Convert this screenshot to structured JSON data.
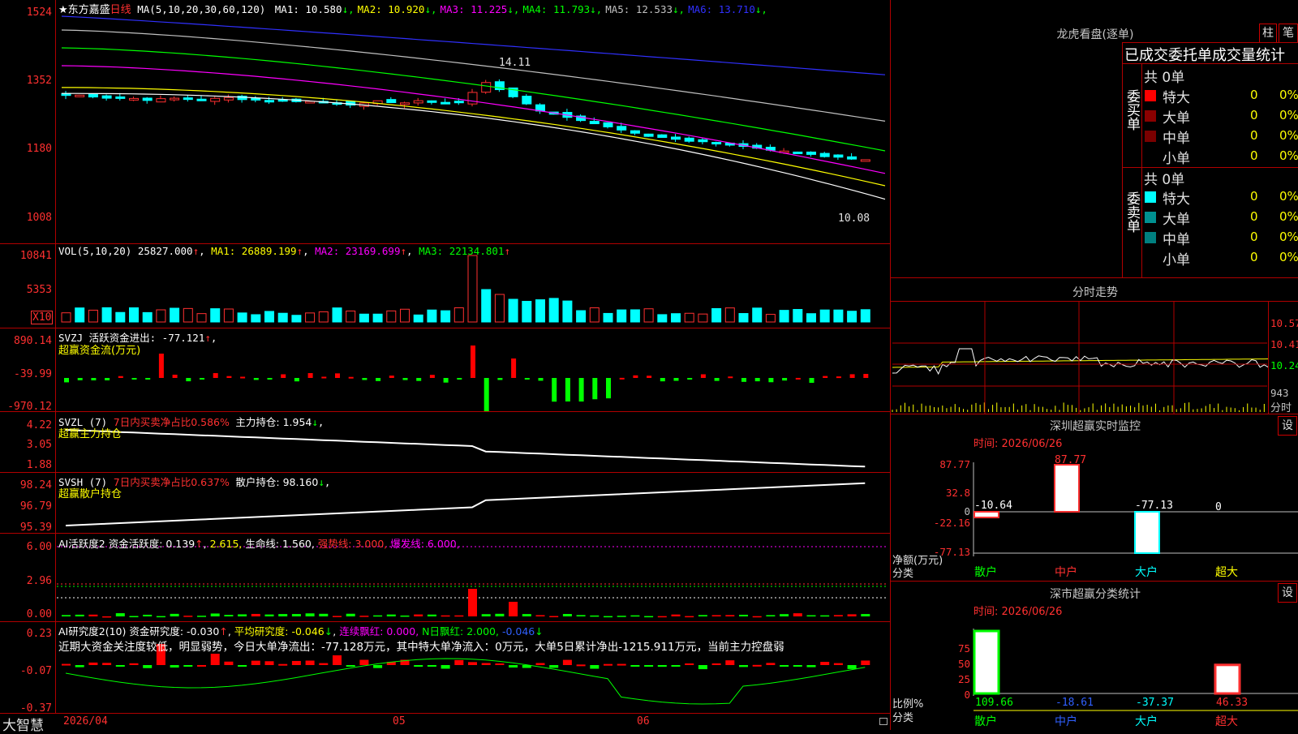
{
  "main_chart": {
    "stock_name": "★东方嘉盛",
    "period": "日线",
    "ma_params": "MA(5,10,20,30,60,120)",
    "ma": [
      {
        "label": "MA1:",
        "value": "10.580",
        "arrow": "↓",
        "color": "#ffffff"
      },
      {
        "label": "MA2:",
        "value": "10.920",
        "arrow": "↓",
        "color": "#ffff00"
      },
      {
        "label": "MA3:",
        "value": "11.225",
        "arrow": "↓",
        "color": "#ff00ff"
      },
      {
        "label": "MA4:",
        "value": "11.793",
        "arrow": "↓",
        "color": "#00ff00"
      },
      {
        "label": "MA5:",
        "value": "12.533",
        "arrow": "↓",
        "color": "#c0c0c0"
      },
      {
        "label": "MA6:",
        "value": "13.710",
        "arrow": "↓",
        "color": "#3030ff"
      }
    ],
    "y_labels": [
      "1524",
      "1352",
      "1180",
      "1008"
    ],
    "high_mark": "14.11",
    "low_mark": "10.08"
  },
  "vol_chart": {
    "title": "VOL(5,10,20)",
    "value": "25827.000",
    "ma1": "MA1: 26889.199",
    "ma2": "MA2: 23169.699",
    "ma3": "MA3: 22134.801",
    "y_labels": [
      "10841",
      "5353"
    ],
    "unit": "X10"
  },
  "svzj_chart": {
    "title": "SVZJ  活跃资金进出: -77.121",
    "subtitle": "超赢资金流(万元)",
    "y_labels": [
      "890.14",
      "-39.99",
      "-970.12"
    ]
  },
  "svzl_chart": {
    "title": "SVZL  (7)",
    "ratio": "7日内买卖净占比0.586%",
    "hold": "主力持仓: 1.954",
    "subtitle": "超赢主力持仓",
    "y_labels": [
      "4.22",
      "3.05",
      "1.88"
    ]
  },
  "svsh_chart": {
    "title": "SVSH  (7)",
    "ratio": "7日内买卖净占比0.637%",
    "hold": "散户持仓: 98.160",
    "subtitle": "超赢散户持仓",
    "y_labels": [
      "98.24",
      "96.79",
      "95.39"
    ]
  },
  "ai_active": {
    "title": "AI活跃度2",
    "v1": "资金活跃度: 0.139",
    "v2": "2.615,",
    "v3": "生命线: 1.560,",
    "v4": "强势线: 3.000,",
    "v5": "爆发线: 6.000,",
    "y_labels": [
      "6.00",
      "2.96",
      "0.00"
    ]
  },
  "ai_research": {
    "title": "AI研究度2(10)",
    "v1": "资金研究度: -0.030",
    "v2": "平均研究度: -0.046",
    "v3": "连续飘红: 0.000,",
    "v4": "N日飘红: 2.000,",
    "v5": "-0.046",
    "comment": "近期大资金关注度较低，明显弱势，今日大单净流出：-77.128万元，其中特大单净流入：0万元，大单5日累计净出-1215.911万元，当前主力控盘弱",
    "y_labels": [
      "0.23",
      "-0.07",
      "-0.37"
    ]
  },
  "bottom_axis": {
    "brand": "大智慧",
    "date": "2026/04",
    "m05": "05",
    "m06": "06"
  },
  "dragon_panel": {
    "title": "龙虎看盘(逐单)",
    "btn1": "柱",
    "btn2": "笔",
    "tab": "已成交委托单成交量统计",
    "buy_label": "委买单",
    "sell_label": "委卖单",
    "buy_total": "共 0单",
    "sell_total": "共 0单",
    "buy_rows": [
      {
        "name": "特大",
        "count": "0",
        "pct": "0%",
        "color": "#ff0000"
      },
      {
        "name": "大单",
        "count": "0",
        "pct": "0%",
        "color": "#8b0000"
      },
      {
        "name": "中单",
        "count": "0",
        "pct": "0%",
        "color": "#7a0000"
      },
      {
        "name": "小单",
        "count": "0",
        "pct": "0%",
        "color": "#000000"
      }
    ],
    "sell_rows": [
      {
        "name": "特大",
        "count": "0",
        "pct": "0%",
        "color": "#00ffff"
      },
      {
        "name": "大单",
        "count": "0",
        "pct": "0%",
        "color": "#009090"
      },
      {
        "name": "中单",
        "count": "0",
        "pct": "0%",
        "color": "#007f7f"
      },
      {
        "name": "小单",
        "count": "0",
        "pct": "0%",
        "color": "#000000"
      }
    ]
  },
  "intraday": {
    "title": "分时走势",
    "y_labels": [
      "10.57",
      "10.41",
      "10.24"
    ],
    "vol_label": "943",
    "tag": "分时"
  },
  "sz_monitor": {
    "title": "深圳超赢实时监控",
    "set_btn": "设",
    "time": "时间: 2026/06/26",
    "y_labels": [
      "87.77",
      "32.8",
      "0",
      "-22.16",
      "-77.13"
    ],
    "unit_label": "净额(万元)",
    "class_label": "分类",
    "chart_data": {
      "type": "bar",
      "categories": [
        "散户",
        "中户",
        "大户",
        "超大"
      ],
      "values": [
        -10.64,
        87.77,
        -77.13,
        0
      ],
      "value_labels": [
        "-10.64",
        "87.77",
        "-77.13",
        "0"
      ],
      "ylim": [
        -77.13,
        87.77
      ]
    }
  },
  "sz_class": {
    "title": "深市超赢分类统计",
    "set_btn": "设",
    "time": "时间: 2026/06/26",
    "y_labels": [
      "75",
      "50",
      "25",
      "0"
    ],
    "ratio_label": "比例%",
    "class_label": "分类",
    "chart_data": {
      "type": "bar",
      "categories": [
        "散户",
        "中户",
        "大户",
        "超大"
      ],
      "values": [
        109.66,
        -18.61,
        -37.37,
        46.33
      ],
      "value_labels": [
        "109.66",
        "-18.61",
        "-37.37",
        "46.33"
      ],
      "ylim": [
        0,
        75
      ]
    }
  }
}
